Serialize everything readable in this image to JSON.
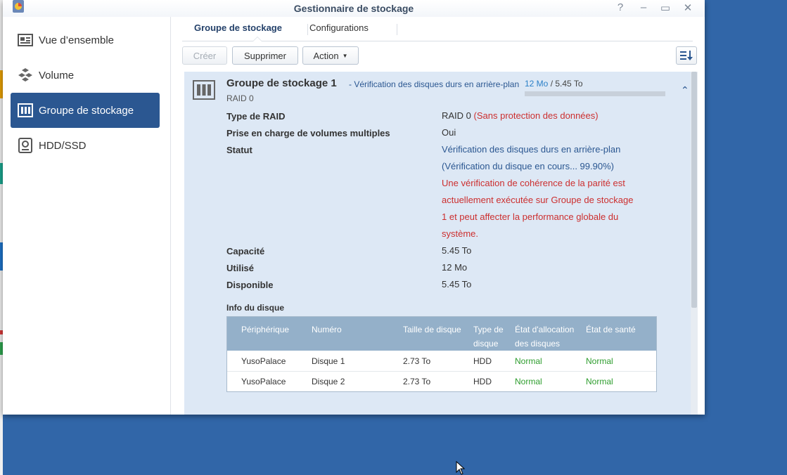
{
  "window": {
    "title": "Gestionnaire de stockage"
  },
  "sidebar": {
    "items": [
      {
        "label": "Vue d’ensemble",
        "icon": "overview-icon"
      },
      {
        "label": "Volume",
        "icon": "volume-icon"
      },
      {
        "label": "Groupe de stockage",
        "icon": "storage-pool-icon",
        "active": true
      },
      {
        "label": "HDD/SSD",
        "icon": "hdd-icon"
      }
    ]
  },
  "tabs": [
    {
      "label": "Groupe de stockage",
      "active": true
    },
    {
      "label": "Configurations"
    }
  ],
  "toolbar": {
    "create": "Créer",
    "delete": "Supprimer",
    "action": "Action"
  },
  "pool": {
    "title": "Groupe de stockage 1",
    "status_suffix": "- Vérification des disques durs en arrière-plan",
    "used": "12 Mo",
    "used_sep": " / ",
    "total": "5.45 To",
    "raid": "RAID 0",
    "details": {
      "raid_type_label": "Type de RAID",
      "raid_type_value": "RAID 0",
      "raid_type_warning": "(Sans protection des données)",
      "multi_volume_label": "Prise en charge de volumes multiples",
      "multi_volume_value": "Oui",
      "status_label": "Statut",
      "status_line1": "Vérification des disques durs en arrière-plan",
      "status_line2": "(Vérification du disque en cours... 99.90%)",
      "warning_line1": "Une vérification de cohérence de la parité est",
      "warning_line2": "actuellement exécutée sur Groupe de stockage",
      "warning_line3": "1 et peut affecter la performance globale du",
      "warning_line4": "système.",
      "capacity_label": "Capacité",
      "capacity_value": "5.45 To",
      "used_label": "Utilisé",
      "used_value": "12 Mo",
      "available_label": "Disponible",
      "available_value": "5.45 To"
    },
    "disk_info_title": "Info du disque",
    "disk_table": {
      "headers": {
        "device": "Périphérique",
        "number": "Numéro",
        "size": "Taille de disque",
        "type1": "Type de",
        "type2": "disque",
        "alloc1": "État d'allocation",
        "alloc2": "des disques",
        "health": "État de santé"
      },
      "rows": [
        {
          "device": "YusoPalace",
          "number": "Disque 1",
          "size": "2.73 To",
          "type": "HDD",
          "alloc": "Normal",
          "health": "Normal"
        },
        {
          "device": "YusoPalace",
          "number": "Disque 2",
          "size": "2.73 To",
          "type": "HDD",
          "alloc": "Normal",
          "health": "Normal"
        }
      ]
    }
  }
}
